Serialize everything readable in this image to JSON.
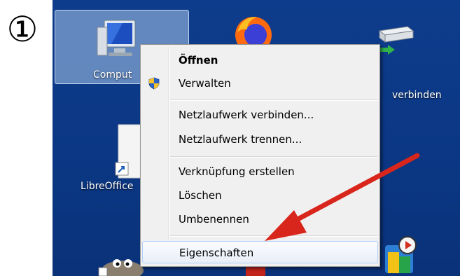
{
  "step": {
    "number": "①"
  },
  "desktop": {
    "icons": {
      "computer": {
        "label": "Computer",
        "visible_label": "Comput"
      },
      "drive": {
        "label": "verbinden"
      },
      "libreoffice": {
        "label": "LibreOffice"
      }
    }
  },
  "context_menu": {
    "items": [
      {
        "label": "Öffnen",
        "bold": true
      },
      {
        "label": "Verwalten",
        "icon": "uac-shield-icon"
      },
      {
        "label": "Netzlaufwerk verbinden..."
      },
      {
        "label": "Netzlaufwerk trennen..."
      },
      {
        "label": "Verknüpfung erstellen"
      },
      {
        "label": "Löschen"
      },
      {
        "label": "Umbenennen"
      },
      {
        "label": "Eigenschaften",
        "highlighted": true
      }
    ]
  },
  "colors": {
    "desktop_background": "#0b3784",
    "menu_background": "#f0f0f0",
    "menu_highlight_border": "#aecff7",
    "arrow": "#d9261c"
  }
}
